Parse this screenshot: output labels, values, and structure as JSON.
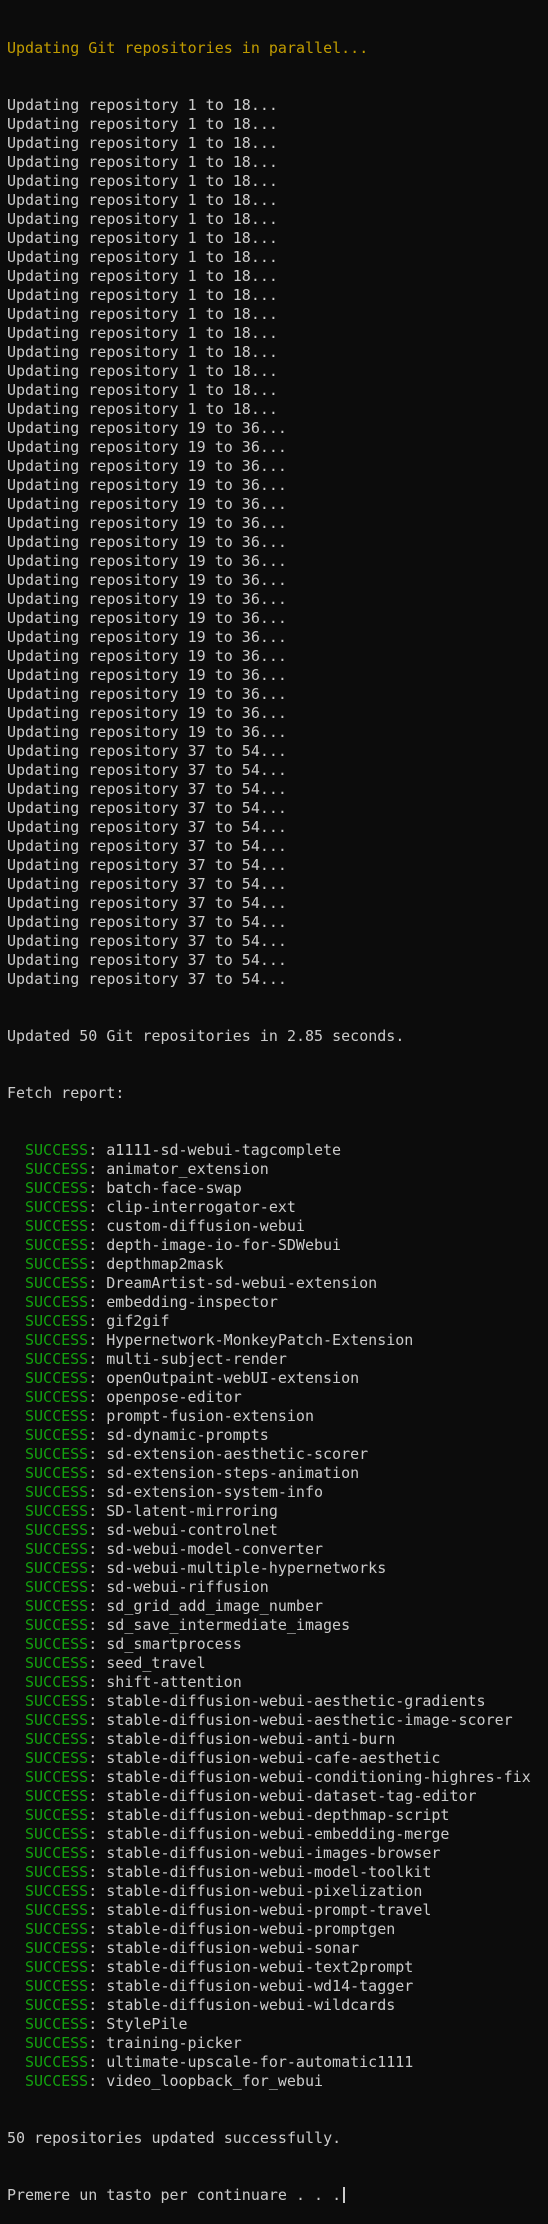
{
  "terminal": {
    "header": "Updating Git repositories in parallel...",
    "progress_lines": [
      "Updating repository 1 to 18...",
      "Updating repository 1 to 18...",
      "Updating repository 1 to 18...",
      "Updating repository 1 to 18...",
      "Updating repository 1 to 18...",
      "Updating repository 1 to 18...",
      "Updating repository 1 to 18...",
      "Updating repository 1 to 18...",
      "Updating repository 1 to 18...",
      "Updating repository 1 to 18...",
      "Updating repository 1 to 18...",
      "Updating repository 1 to 18...",
      "Updating repository 1 to 18...",
      "Updating repository 1 to 18...",
      "Updating repository 1 to 18...",
      "Updating repository 1 to 18...",
      "Updating repository 1 to 18...",
      "Updating repository 19 to 36...",
      "Updating repository 19 to 36...",
      "Updating repository 19 to 36...",
      "Updating repository 19 to 36...",
      "Updating repository 19 to 36...",
      "Updating repository 19 to 36...",
      "Updating repository 19 to 36...",
      "Updating repository 19 to 36...",
      "Updating repository 19 to 36...",
      "Updating repository 19 to 36...",
      "Updating repository 19 to 36...",
      "Updating repository 19 to 36...",
      "Updating repository 19 to 36...",
      "Updating repository 19 to 36...",
      "Updating repository 19 to 36...",
      "Updating repository 19 to 36...",
      "Updating repository 19 to 36...",
      "Updating repository 37 to 54...",
      "Updating repository 37 to 54...",
      "Updating repository 37 to 54...",
      "Updating repository 37 to 54...",
      "Updating repository 37 to 54...",
      "Updating repository 37 to 54...",
      "Updating repository 37 to 54...",
      "Updating repository 37 to 54...",
      "Updating repository 37 to 54...",
      "Updating repository 37 to 54...",
      "Updating repository 37 to 54...",
      "Updating repository 37 to 54...",
      "Updating repository 37 to 54..."
    ],
    "summary": "Updated 50 Git repositories in 2.85 seconds.",
    "report_title": "Fetch report:",
    "status_label": "SUCCESS",
    "report_items": [
      "a1111-sd-webui-tagcomplete",
      "animator_extension",
      "batch-face-swap",
      "clip-interrogator-ext",
      "custom-diffusion-webui",
      "depth-image-io-for-SDWebui",
      "depthmap2mask",
      "DreamArtist-sd-webui-extension",
      "embedding-inspector",
      "gif2gif",
      "Hypernetwork-MonkeyPatch-Extension",
      "multi-subject-render",
      "openOutpaint-webUI-extension",
      "openpose-editor",
      "prompt-fusion-extension",
      "sd-dynamic-prompts",
      "sd-extension-aesthetic-scorer",
      "sd-extension-steps-animation",
      "sd-extension-system-info",
      "SD-latent-mirroring",
      "sd-webui-controlnet",
      "sd-webui-model-converter",
      "sd-webui-multiple-hypernetworks",
      "sd-webui-riffusion",
      "sd_grid_add_image_number",
      "sd_save_intermediate_images",
      "sd_smartprocess",
      "seed_travel",
      "shift-attention",
      "stable-diffusion-webui-aesthetic-gradients",
      "stable-diffusion-webui-aesthetic-image-scorer",
      "stable-diffusion-webui-anti-burn",
      "stable-diffusion-webui-cafe-aesthetic",
      "stable-diffusion-webui-conditioning-highres-fix",
      "stable-diffusion-webui-dataset-tag-editor",
      "stable-diffusion-webui-depthmap-script",
      "stable-diffusion-webui-embedding-merge",
      "stable-diffusion-webui-images-browser",
      "stable-diffusion-webui-model-toolkit",
      "stable-diffusion-webui-pixelization",
      "stable-diffusion-webui-prompt-travel",
      "stable-diffusion-webui-promptgen",
      "stable-diffusion-webui-sonar",
      "stable-diffusion-webui-text2prompt",
      "stable-diffusion-webui-wd14-tagger",
      "stable-diffusion-webui-wildcards",
      "StylePile",
      "training-picker",
      "ultimate-upscale-for-automatic1111",
      "video_loopback_for_webui"
    ],
    "final_message": "50 repositories updated successfully.",
    "prompt": "Premere un tasto per continuare . . ."
  },
  "colors": {
    "background": "#0c0c0c",
    "foreground": "#cccccc",
    "header": "#c19c00",
    "success": "#13a10e"
  }
}
